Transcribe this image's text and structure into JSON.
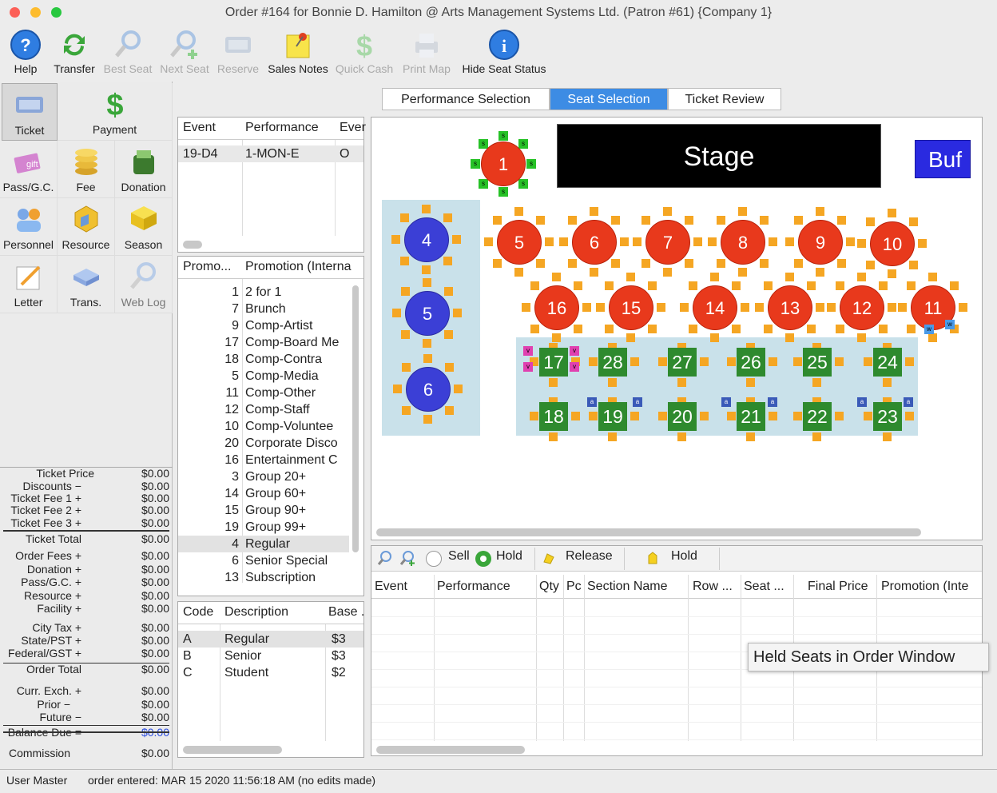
{
  "window": {
    "title": "Order #164 for Bonnie D. Hamilton @ Arts Management Systems Ltd. (Patron #61) {Company 1}"
  },
  "toolbar": {
    "items": [
      {
        "label": "Help",
        "icon": "help-icon",
        "enabled": true
      },
      {
        "label": "Transfer",
        "icon": "transfer-icon",
        "enabled": true
      },
      {
        "label": "Best Seat",
        "icon": "best-seat-icon",
        "enabled": false
      },
      {
        "label": "Next Seat",
        "icon": "next-seat-icon",
        "enabled": false
      },
      {
        "label": "Reserve",
        "icon": "reserve-icon",
        "enabled": false
      },
      {
        "label": "Sales Notes",
        "icon": "sales-notes-icon",
        "enabled": true
      },
      {
        "label": "Quick Cash",
        "icon": "quick-cash-icon",
        "enabled": false
      },
      {
        "label": "Print Map",
        "icon": "print-map-icon",
        "enabled": false
      },
      {
        "label": "Hide Seat Status",
        "icon": "info-icon",
        "enabled": true
      }
    ]
  },
  "sidebar": {
    "items": [
      {
        "label": "Ticket",
        "icon": "ticket-icon"
      },
      {
        "label": "Payment",
        "icon": "payment-icon"
      },
      {
        "label": "Pass/G.C.",
        "icon": "gift-card-icon"
      },
      {
        "label": "Fee",
        "icon": "fee-icon"
      },
      {
        "label": "Donation",
        "icon": "donation-icon"
      },
      {
        "label": "Personnel",
        "icon": "personnel-icon"
      },
      {
        "label": "Resource",
        "icon": "resource-icon"
      },
      {
        "label": "Season",
        "icon": "season-icon"
      },
      {
        "label": "Letter",
        "icon": "letter-icon"
      },
      {
        "label": "Trans.",
        "icon": "trans-icon"
      },
      {
        "label": "Web Log",
        "icon": "web-log-icon"
      }
    ]
  },
  "totals": [
    {
      "label": "Ticket Price",
      "value": "$0.00"
    },
    {
      "label": "Discounts −",
      "value": "$0.00"
    },
    {
      "label": "Ticket Fee 1 +",
      "value": "$0.00"
    },
    {
      "label": "Ticket Fee 2 +",
      "value": "$0.00"
    },
    {
      "label": "Ticket Fee 3 +",
      "value": "$0.00"
    },
    {
      "label": "Ticket Total",
      "value": "$0.00"
    },
    {
      "label": "Order Fees +",
      "value": "$0.00"
    },
    {
      "label": "Donation +",
      "value": "$0.00"
    },
    {
      "label": "Pass/G.C. +",
      "value": "$0.00"
    },
    {
      "label": "Resource +",
      "value": "$0.00"
    },
    {
      "label": "Facility +",
      "value": "$0.00"
    },
    {
      "label": "City Tax +",
      "value": "$0.00"
    },
    {
      "label": "State/PST +",
      "value": "$0.00"
    },
    {
      "label": "Federal/GST +",
      "value": "$0.00"
    },
    {
      "label": "Order Total",
      "value": "$0.00"
    },
    {
      "label": "Curr. Exch. +",
      "value": "$0.00"
    },
    {
      "label": "Prior −",
      "value": "$0.00"
    },
    {
      "label": "Future −",
      "value": "$0.00"
    },
    {
      "label": "Balance Due =",
      "value": "$0.00"
    },
    {
      "label": "Commission",
      "value": "$0.00"
    }
  ],
  "tabs": [
    "Performance Selection",
    "Seat Selection",
    "Ticket Review"
  ],
  "event_table": {
    "headers": [
      "Event",
      "Performance",
      "Ever"
    ],
    "rows": [
      [
        "19-D4",
        "1-MON-E",
        "O"
      ]
    ]
  },
  "promo_table": {
    "headers": [
      "Promo...",
      "Promotion (Interna"
    ],
    "rows": [
      [
        "1",
        "2 for 1"
      ],
      [
        "7",
        "Brunch"
      ],
      [
        "9",
        "Comp-Artist"
      ],
      [
        "17",
        "Comp-Board Me"
      ],
      [
        "18",
        "Comp-Contra"
      ],
      [
        "5",
        "Comp-Media"
      ],
      [
        "11",
        "Comp-Other"
      ],
      [
        "12",
        "Comp-Staff"
      ],
      [
        "10",
        "Comp-Voluntee"
      ],
      [
        "20",
        "Corporate Disco"
      ],
      [
        "16",
        "Entertainment C"
      ],
      [
        "3",
        "Group 20+"
      ],
      [
        "14",
        "Group 60+"
      ],
      [
        "15",
        "Group 90+"
      ],
      [
        "19",
        "Group 99+"
      ],
      [
        "4",
        "Regular"
      ],
      [
        "6",
        "Senior Special"
      ],
      [
        "13",
        "Subscription"
      ]
    ]
  },
  "price_table": {
    "headers": [
      "Code",
      "Description",
      "Base ."
    ],
    "rows": [
      [
        "A",
        "Regular",
        "$3"
      ],
      [
        "B",
        "Senior",
        "$3"
      ],
      [
        "C",
        "Student",
        "$2"
      ]
    ]
  },
  "map": {
    "stage": "Stage",
    "buffet": "Buf",
    "round_tables_red": [
      "1",
      "5",
      "6",
      "7",
      "8",
      "9",
      "10",
      "16",
      "15",
      "14",
      "13",
      "12",
      "11"
    ],
    "round_tables_blue": [
      "4",
      "5",
      "6"
    ],
    "square_tables": [
      "17",
      "28",
      "27",
      "26",
      "25",
      "24",
      "18",
      "19",
      "20",
      "21",
      "22",
      "23"
    ],
    "seat_letters": {
      "s": "s",
      "v": "v",
      "a": "a",
      "w": "w"
    }
  },
  "held": {
    "sell": "Sell",
    "hold": "Hold",
    "release": "Release",
    "hold_button": "Hold",
    "headers": [
      "Event",
      "Performance",
      "Qty",
      "Pc",
      "Section Name",
      "Row ...",
      "Seat ...",
      "Final Price",
      "Promotion (Inte"
    ],
    "tooltip": "Held Seats in Order Window"
  },
  "status": {
    "user": "User Master",
    "message": "order entered: MAR 15 2020 11:56:18 AM (no edits made)"
  },
  "colors": {
    "accent": "#3d8ce4",
    "table_red": "#e8391c",
    "table_blue": "#3b3fd6",
    "table_green": "#2e8a2e",
    "seat": "#f5a623"
  }
}
